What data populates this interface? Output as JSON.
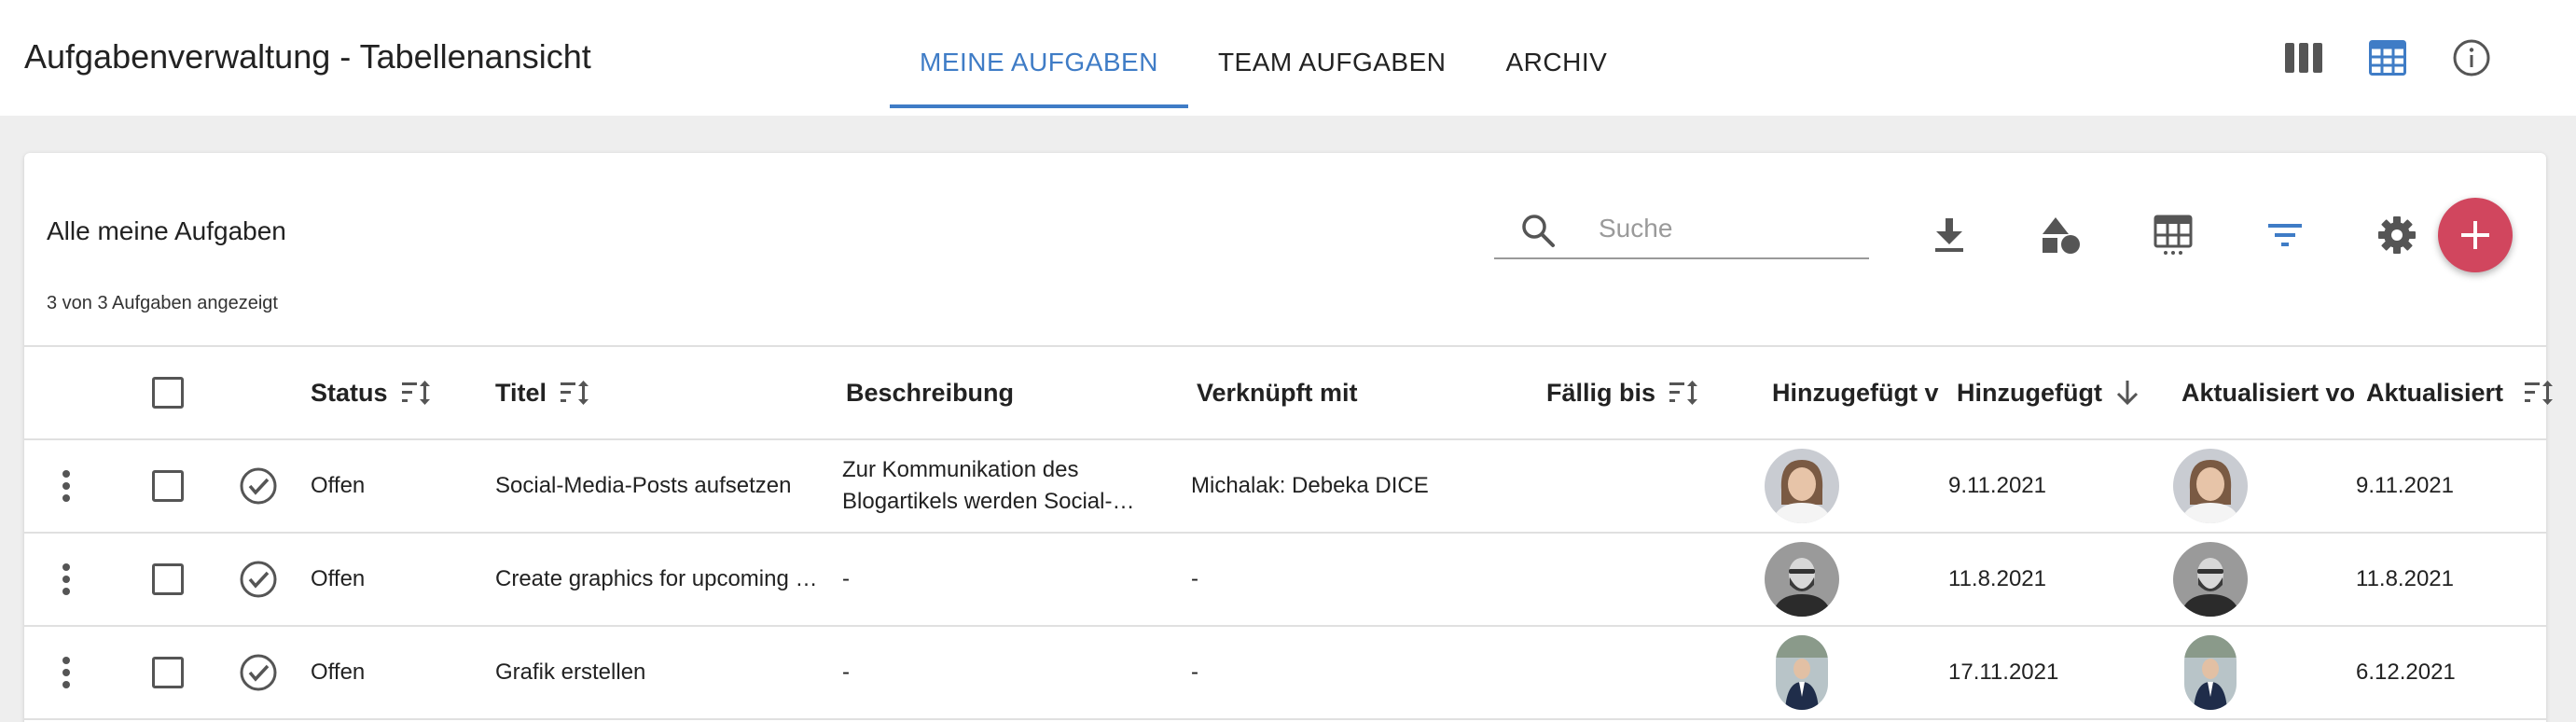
{
  "app": {
    "title": "Aufgabenverwaltung - Tabellenansicht"
  },
  "tabs": [
    {
      "label": "MEINE AUFGABEN",
      "active": true
    },
    {
      "label": "TEAM AUFGABEN",
      "active": false
    },
    {
      "label": "ARCHIV",
      "active": false
    }
  ],
  "top_icons": [
    "column-view-icon",
    "table-view-icon",
    "info-icon"
  ],
  "card": {
    "title": "Alle meine Aufgaben",
    "count_text": "3 von 3 Aufgaben angezeigt"
  },
  "search": {
    "placeholder": "Suche",
    "value": ""
  },
  "toolbar_icons": [
    "download-icon",
    "shapes-icon",
    "table-columns-icon",
    "filter-icon",
    "settings-icon",
    "add-icon"
  ],
  "colors": {
    "accent": "#3f7cc6",
    "fab": "#d1465e"
  },
  "table": {
    "headers": {
      "status": "Status",
      "title": "Titel",
      "description": "Beschreibung",
      "linked": "Verknüpft mit",
      "due": "Fällig bis",
      "added_by": "Hinzugefügt v",
      "added": "Hinzugefügt",
      "updated_by": "Aktualisiert vo",
      "updated": "Aktualisiert"
    },
    "rows": [
      {
        "status": "Offen",
        "title": "Social-Media-Posts aufsetzen",
        "description": "Zur Kommunikation des Blogartikels werden Social-…",
        "linked": "Michalak: Debeka DICE",
        "due": "",
        "added_by_avatar": "woman-avatar",
        "added": "9.11.2021",
        "updated_by_avatar": "woman-avatar",
        "updated": "9.11.2021"
      },
      {
        "status": "Offen",
        "title": "Create graphics for upcoming …",
        "description": "-",
        "linked": "-",
        "due": "",
        "added_by_avatar": "man-beard-avatar",
        "added": "11.8.2021",
        "updated_by_avatar": "man-beard-avatar",
        "updated": "11.8.2021"
      },
      {
        "status": "Offen",
        "title": "Grafik erstellen",
        "description": "-",
        "linked": "-",
        "due": "",
        "added_by_avatar": "man-suit-avatar",
        "added": "17.11.2021",
        "updated_by_avatar": "man-suit-avatar",
        "updated": "6.12.2021"
      }
    ]
  }
}
